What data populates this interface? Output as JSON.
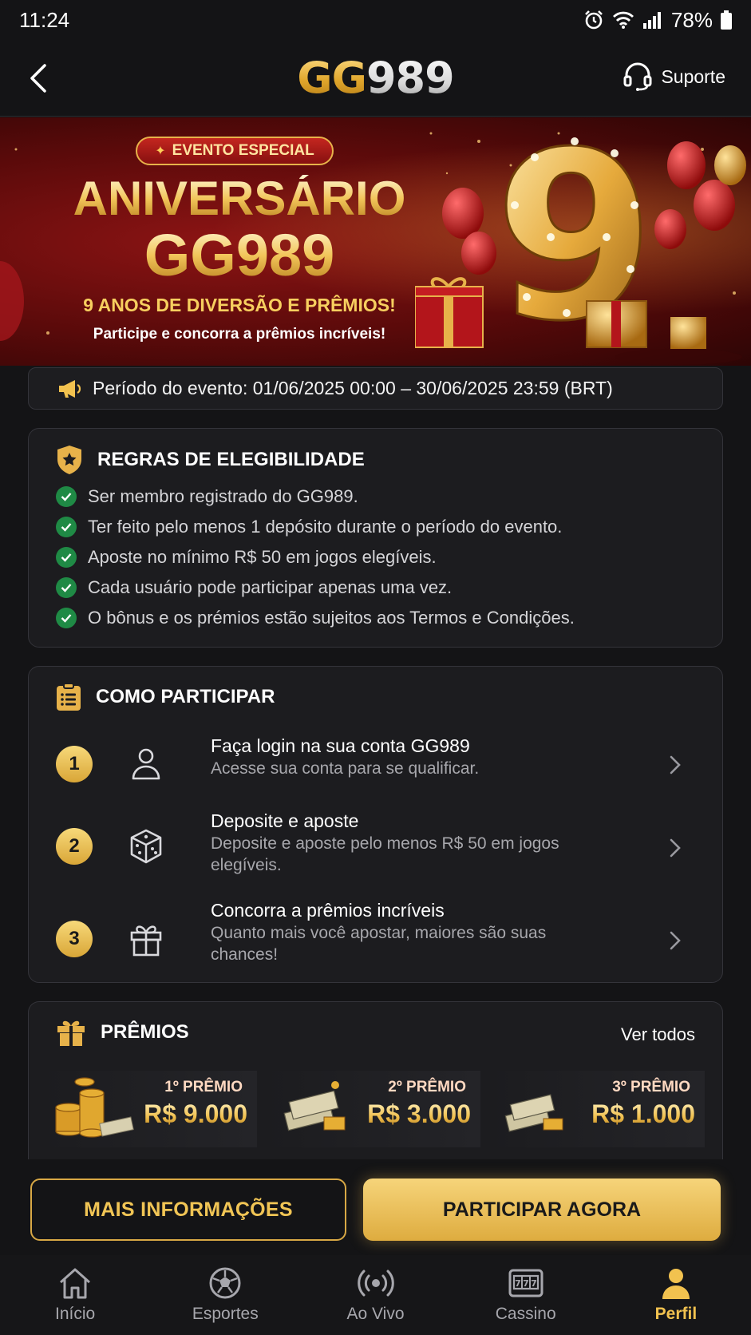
{
  "status_bar": {
    "time": "11:24",
    "battery": "78%"
  },
  "header": {
    "logo_gg": "GG",
    "logo_num": "989",
    "support_label": "Suporte"
  },
  "banner": {
    "badge": "EVENTO ESPECIAL",
    "title_line1": "ANIVERSÁRIO",
    "title_line2": "GG989",
    "subtitle": "9 ANOS DE DIVERSÃO E PRÊMIOS!",
    "cta_text": "Participe e concorra a prêmios incríveis!",
    "big_number": "9"
  },
  "period": {
    "text": "Período do evento: 01/06/2025 00:00 – 30/06/2025 23:59 (BRT)"
  },
  "rules": {
    "title": "REGRAS DE ELEGIBILIDADE",
    "items": [
      "Ser membro registrado do GG989.",
      "Ter feito pelo menos 1 depósito durante o período do evento.",
      "Aposte no mínimo R$ 50 em jogos elegíveis.",
      "Cada usuário pode participar apenas uma vez.",
      "O bônus e os prémios estão sujeitos aos Termos e Condições."
    ]
  },
  "how_to": {
    "title": "COMO PARTICIPAR",
    "steps": [
      {
        "number": "1",
        "icon": "user-icon",
        "title": "Faça login na sua conta GG989",
        "desc": "Acesse sua conta para se qualificar."
      },
      {
        "number": "2",
        "icon": "dice-icon",
        "title": "Deposite e aposte",
        "desc": "Deposite e aposte pelo menos R$ 50 em jogos elegíveis."
      },
      {
        "number": "3",
        "icon": "gift-icon",
        "title": "Concorra a prêmios incríveis",
        "desc": "Quanto mais você apostar, maiores são suas chances!"
      }
    ]
  },
  "prizes": {
    "title": "PRÊMIOS",
    "see_all": "Ver todos",
    "items": [
      {
        "label": "1º PRÊMIO",
        "value": "R$ 9.000"
      },
      {
        "label": "2º PRÊMIO",
        "value": "R$ 3.000"
      },
      {
        "label": "3º PRÊMIO",
        "value": "R$ 1.000"
      }
    ]
  },
  "actions": {
    "more_info": "MAIS INFORMAÇÕES",
    "participate": "PARTICIPAR AGORA"
  },
  "nav": {
    "items": [
      {
        "label": "Início",
        "icon": "home-icon"
      },
      {
        "label": "Esportes",
        "icon": "soccer-ball-icon"
      },
      {
        "label": "Ao Vivo",
        "icon": "live-broadcast-icon"
      },
      {
        "label": "Cassino",
        "icon": "slot-machine-icon"
      },
      {
        "label": "Perfil",
        "icon": "profile-icon"
      }
    ],
    "active_index": 4
  },
  "colors": {
    "gold": "#f2c24f",
    "background": "#141416",
    "card": "#1c1c1f",
    "check_green": "#1f8a45",
    "banner_red": "#8c1414"
  }
}
